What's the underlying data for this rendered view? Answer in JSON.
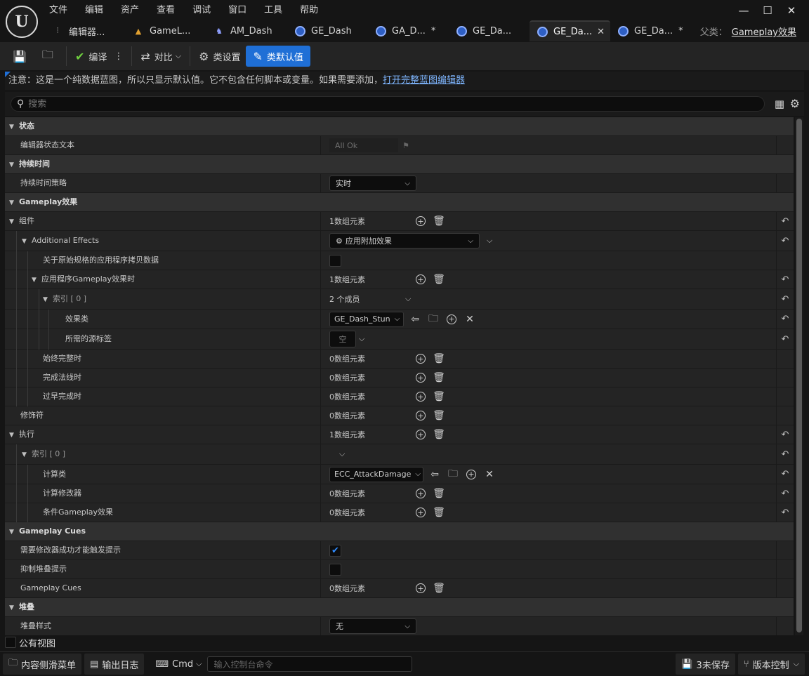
{
  "logo": "U",
  "menu": [
    "文件",
    "编辑",
    "资产",
    "查看",
    "调试",
    "窗口",
    "工具",
    "帮助"
  ],
  "window_controls": {
    "minimize": "—",
    "maximize": "☐",
    "close": "✕"
  },
  "tabs": [
    {
      "label": "编辑器...",
      "icon": "sliders-icon",
      "glyph": "⫶",
      "active": false
    },
    {
      "label": "GameL...",
      "icon": "level-icon",
      "glyph": "▲",
      "active": false
    },
    {
      "label": "AM_Dash",
      "icon": "montage-icon",
      "glyph": "♞",
      "active": false
    },
    {
      "label": "GE_Dash",
      "icon": "gameplay-effect-icon",
      "active": false
    },
    {
      "label": "GA_D...",
      "icon": "gameplay-ability-icon",
      "active": false,
      "modified": "*"
    },
    {
      "label": "GE_Da...",
      "icon": "gameplay-effect-icon",
      "active": false
    },
    {
      "label": "GE_Da...",
      "icon": "gameplay-effect-icon",
      "active": true,
      "close": "✕"
    },
    {
      "label": "GE_Da...",
      "icon": "gameplay-effect-icon",
      "active": false,
      "modified": "*"
    }
  ],
  "parent": {
    "label": "父类：",
    "value": "Gameplay效果"
  },
  "toolbar": {
    "compile": "编译",
    "diff": "对比",
    "class_settings": "类设置",
    "class_defaults": "类默认值",
    "more": "⋮",
    "chev": "⌵"
  },
  "info": {
    "text": "注意：这是一个纯数据蓝图，所以只显示默认值。它不包含任何脚本或变量。如果需要添加，",
    "link": "打开完整蓝图编辑器"
  },
  "search": {
    "placeholder": "搜索"
  },
  "details": {
    "cat_state": "状态",
    "editor_state_text": "编辑器状态文本",
    "state_value": "All Ok",
    "cat_duration": "持续时间",
    "duration_policy": "持续时间策略",
    "duration_value": "实时",
    "cat_gameplay_effect": "Gameplay效果",
    "components": "组件",
    "components_count": "1数组元素",
    "additional_effects": "Additional Effects",
    "additional_effects_value": "应用附加效果",
    "copy_data": "关于原始规格的应用程序拷贝数据",
    "on_application": "应用程序Gameplay效果时",
    "on_application_count": "1数组元素",
    "index0": "索引 [ 0 ]",
    "index0_members": "2 个成员",
    "effect_class": "效果类",
    "effect_class_value": "GE_Dash_Stun",
    "required_source_tags": "所需的源标签",
    "required_source_tags_value": "空",
    "on_complete_always": "始终完整时",
    "on_complete_always_count": "0数组元素",
    "on_complete_normal": "完成法线时",
    "on_complete_normal_count": "0数组元素",
    "on_complete_prematurely": "过早完成时",
    "on_complete_prematurely_count": "0数组元素",
    "modifiers": "修饰符",
    "modifiers_count": "0数组元素",
    "executions": "执行",
    "executions_count": "1数组元素",
    "exec_index0": "索引 [ 0 ]",
    "calculation_class": "计算类",
    "calculation_class_value": "ECC_AttackDamage",
    "calculation_modifiers": "计算修改器",
    "calculation_modifiers_count": "0数组元素",
    "conditional_effects": "条件Gameplay效果",
    "conditional_effects_count": "0数组元素",
    "cat_gameplay_cues": "Gameplay Cues",
    "require_modifier_success": "需要修改器成功才能触发提示",
    "require_modifier_success_checked": true,
    "suppress_stacking_cues": "抑制堆叠提示",
    "suppress_stacking_cues_checked": false,
    "gameplay_cues": "Gameplay Cues",
    "gameplay_cues_count": "0数组元素",
    "cat_stacking": "堆叠",
    "stacking_type": "堆叠样式",
    "stacking_type_value": "无"
  },
  "public_view": "公有视图",
  "statusbar": {
    "content_drawer": "内容侧滑菜单",
    "output_log": "输出日志",
    "cmd": "Cmd",
    "console_placeholder": "输入控制台命令",
    "unsaved": "3未保存",
    "source_control": "版本控制"
  }
}
